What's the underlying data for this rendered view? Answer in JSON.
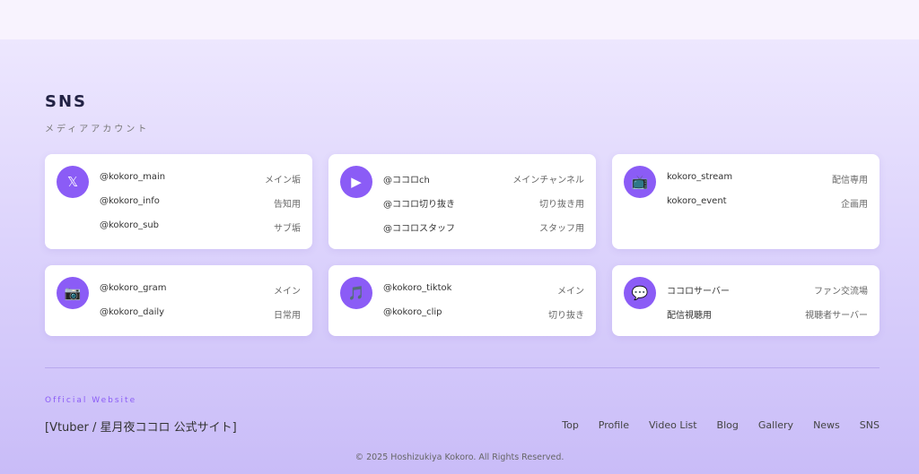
{
  "section": {
    "title": "SNS",
    "subtitle": "メディアアカウント"
  },
  "cards": [
    {
      "icon": "𝕏",
      "icon_name": "x-logo",
      "rows": [
        {
          "name": "@kokoro_main",
          "desc": "メイン垢"
        },
        {
          "name": "@kokoro_info",
          "desc": "告知用"
        },
        {
          "name": "@kokoro_sub",
          "desc": "サブ垢"
        }
      ]
    },
    {
      "icon": "▶",
      "icon_name": "play",
      "rows": [
        {
          "name": "@ココロch",
          "desc": "メインチャンネル"
        },
        {
          "name": "@ココロ切り抜き",
          "desc": "切り抜き用"
        },
        {
          "name": "@ココロスタッフ",
          "desc": "スタッフ用"
        }
      ]
    },
    {
      "icon": "📺",
      "icon_name": "tv",
      "rows": [
        {
          "name": "kokoro_stream",
          "desc": "配信専用"
        },
        {
          "name": "kokoro_event",
          "desc": "企画用"
        }
      ]
    },
    {
      "icon": "📷",
      "icon_name": "camera",
      "rows": [
        {
          "name": "@kokoro_gram",
          "desc": "メイン"
        },
        {
          "name": "@kokoro_daily",
          "desc": "日常用"
        }
      ]
    },
    {
      "icon": "🎵",
      "icon_name": "music",
      "rows": [
        {
          "name": "@kokoro_tiktok",
          "desc": "メイン"
        },
        {
          "name": "@kokoro_clip",
          "desc": "切り抜き"
        }
      ]
    },
    {
      "icon": "💬",
      "icon_name": "chat",
      "rows": [
        {
          "name": "ココロサーバー",
          "desc": "ファン交流場"
        },
        {
          "name": "配信視聴用",
          "desc": "視聴者サーバー"
        }
      ]
    }
  ],
  "footer": {
    "label": "Official Website",
    "site_title": "[Vtuber / 星月夜ココロ 公式サイト]",
    "nav": [
      "Top",
      "Profile",
      "Video List",
      "Blog",
      "Gallery",
      "News",
      "SNS"
    ],
    "copyright": "© 2025 Hoshizukiya Kokoro. All Rights Reserved."
  }
}
